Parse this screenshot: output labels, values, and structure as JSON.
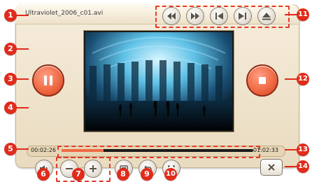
{
  "app": {
    "file_name": "Ultraviolet_2006_c01.avi",
    "time_elapsed": "00:02:26",
    "time_remaining": "01:02:33",
    "progress_percent": 22
  },
  "callouts": [
    "1",
    "2",
    "3",
    "4",
    "5",
    "6",
    "7",
    "8",
    "9",
    "10",
    "11",
    "12",
    "13",
    "14"
  ],
  "colors": {
    "accent_red": "#e12b1b",
    "player_bg": "#efe2c8",
    "play_orange": "#f06a44"
  },
  "icons": {
    "rewind": "rewind-icon",
    "fast_forward": "fast-forward-icon",
    "previous": "skip-previous-icon",
    "next": "skip-next-icon",
    "eject": "eject-icon",
    "pause": "pause-icon",
    "stop": "stop-icon",
    "volume": "volume-icon",
    "zoom_out": "zoom-out-icon",
    "zoom_in": "zoom-in-icon",
    "aspect": "aspect-ratio-icon",
    "repeat": "repeat-icon",
    "fullscreen": "fullscreen-icon",
    "close": "close-icon"
  }
}
